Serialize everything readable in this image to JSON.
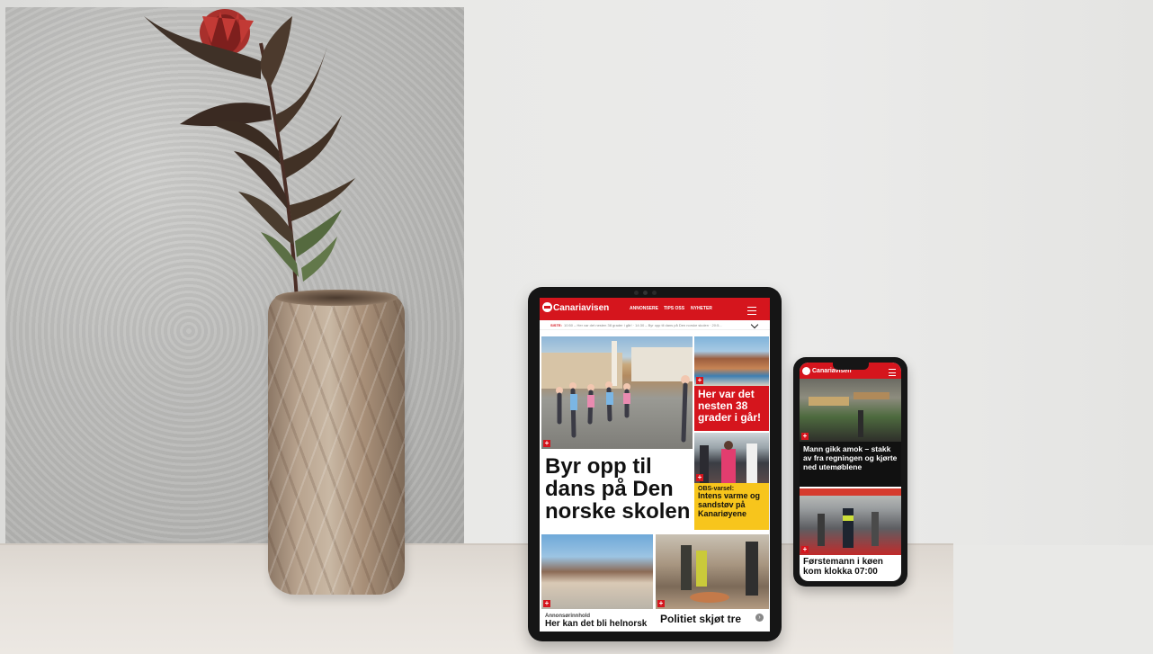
{
  "tablet": {
    "brand": "Canariavisen",
    "nav": [
      "ANNONSERE",
      "TIPS OSS",
      "NYHETER"
    ],
    "ticker_label": "SISTE:",
    "ticker_text": "10:50 – Her var det nesten 38 grader i går! · 14:30 – Byr opp til dans på Den norske skolen · 20:5...",
    "main_headline": "Byr opp til dans på Den norske skolen",
    "side_headline_red": "Her var det nesten 38 grader i går!",
    "yellow_kicker": "OBS-varsel:",
    "yellow_headline": "Intens varme og sandstøv på Kanariøyene",
    "bottom_kicker": "Annonsørinnhold",
    "bottom_left_headline": "Her kan det bli helnorsk",
    "bottom_right_headline": "Politiet skjøt tre"
  },
  "phone": {
    "brand": "Canariavisen",
    "headline_1": "Mann gikk amok – stakk av fra regningen og kjørte ned utemøblene",
    "headline_2": "Førstemann i køen kom klokka 07:00"
  },
  "colors": {
    "brand_red": "#d5151d",
    "alert_yellow": "#f7c51c"
  }
}
